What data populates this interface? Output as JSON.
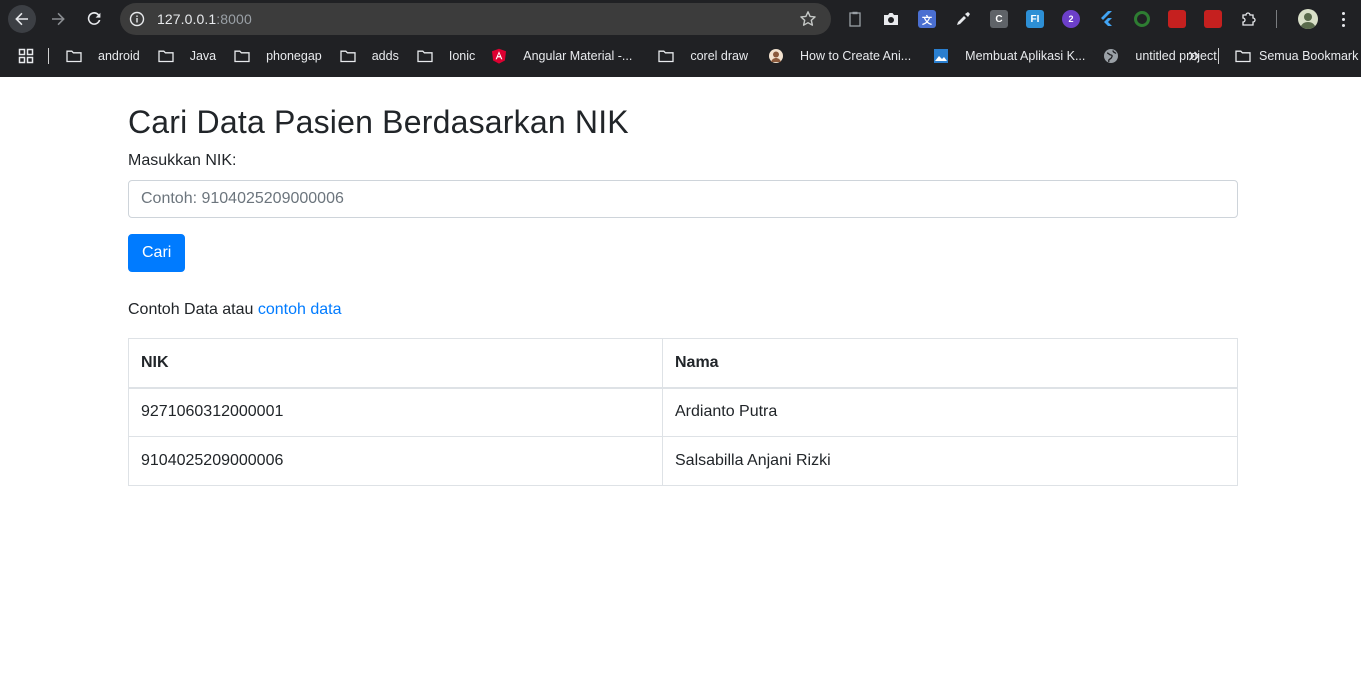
{
  "browser": {
    "url_host": "127.0.0.1",
    "url_port": ":8000",
    "bookmarks": [
      {
        "label": "android",
        "icon": "folder-icon"
      },
      {
        "label": "Java",
        "icon": "folder-icon"
      },
      {
        "label": "phonegap",
        "icon": "folder-icon"
      },
      {
        "label": "adds",
        "icon": "folder-icon"
      },
      {
        "label": "Ionic",
        "icon": "folder-icon"
      },
      {
        "label": "Angular Material -...",
        "icon": "angular-icon"
      },
      {
        "label": "corel draw",
        "icon": "folder-icon"
      },
      {
        "label": "How to Create Ani...",
        "icon": "avatar-favicon-icon"
      },
      {
        "label": "Membuat Aplikasi K...",
        "icon": "image-favicon-icon"
      },
      {
        "label": "untitled project",
        "icon": "globe-icon"
      }
    ],
    "all_bookmarks": "Semua Bookmark",
    "extensions": [
      {
        "name": "clipboard-ext-icon",
        "text": "",
        "color": "#3c3c3c"
      },
      {
        "name": "camera-ext-icon",
        "text": "",
        "color": "#202124"
      },
      {
        "name": "translate-ext-icon",
        "text": "文",
        "color": "#4a6fd1"
      },
      {
        "name": "eyedropper-ext-icon",
        "text": "",
        "color": "#202124"
      },
      {
        "name": "c-ext-icon",
        "text": "C",
        "color": "#5f6368"
      },
      {
        "name": "fi-ext-icon",
        "text": "FI",
        "color": "#2d8fd5"
      },
      {
        "name": "badge-ext-icon",
        "text": "2",
        "color": "#6c3fc9"
      },
      {
        "name": "flutter-ext-icon",
        "text": "",
        "color": "#202124"
      },
      {
        "name": "green-ring-ext-icon",
        "text": "",
        "color": "#202124"
      },
      {
        "name": "pdf-ext-icon",
        "text": "",
        "color": "#c5201f"
      },
      {
        "name": "orange-ext-icon",
        "text": "",
        "color": "#c5201f"
      }
    ]
  },
  "page": {
    "title": "Cari Data Pasien Berdasarkan NIK",
    "input_label": "Masukkan NIK:",
    "input_placeholder": "Contoh: 9104025209000006",
    "search_button": "Cari",
    "hint_text": "Contoh Data atau ",
    "hint_link": "contoh data",
    "table": {
      "headers": [
        "NIK",
        "Nama"
      ],
      "rows": [
        [
          "9271060312000001",
          "Ardianto Putra"
        ],
        [
          "9104025209000006",
          "Salsabilla Anjani Rizki"
        ]
      ]
    }
  }
}
